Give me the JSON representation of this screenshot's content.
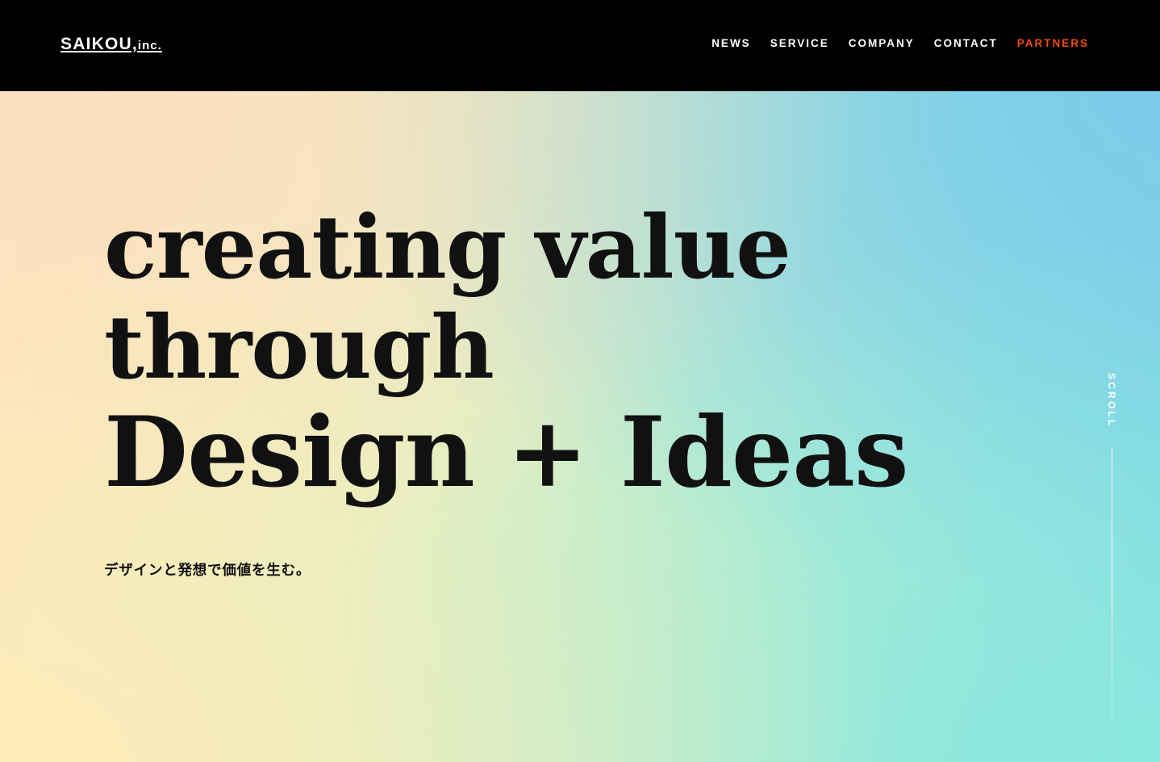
{
  "header": {
    "logo_text": "SAIKOU,",
    "logo_suffix": "inc.",
    "nav": [
      {
        "label": "NEWS",
        "accent": false
      },
      {
        "label": "SERVICE",
        "accent": false
      },
      {
        "label": "COMPANY",
        "accent": false
      },
      {
        "label": "CONTACT",
        "accent": false
      },
      {
        "label": "PARTNERS",
        "accent": true
      }
    ],
    "background_color": "#000000",
    "accent_color": "#F04A14"
  },
  "hero": {
    "headline_line_1": "creating value",
    "headline_line_2": "through",
    "headline_line_3": "Design + Ideas",
    "subtitle": "デザインと発想で価値を生む。",
    "text_color": "#111111",
    "gradient": {
      "top_left": "#FBE0C0",
      "top_right": "#7CCDE8",
      "bottom_left": "#FCEDBC",
      "bottom_right": "#8CE7DE",
      "center_bottom": "#C8F0CB"
    }
  },
  "scroll_indicator": {
    "label": "SCROLL",
    "color": "#FFFFFF"
  }
}
